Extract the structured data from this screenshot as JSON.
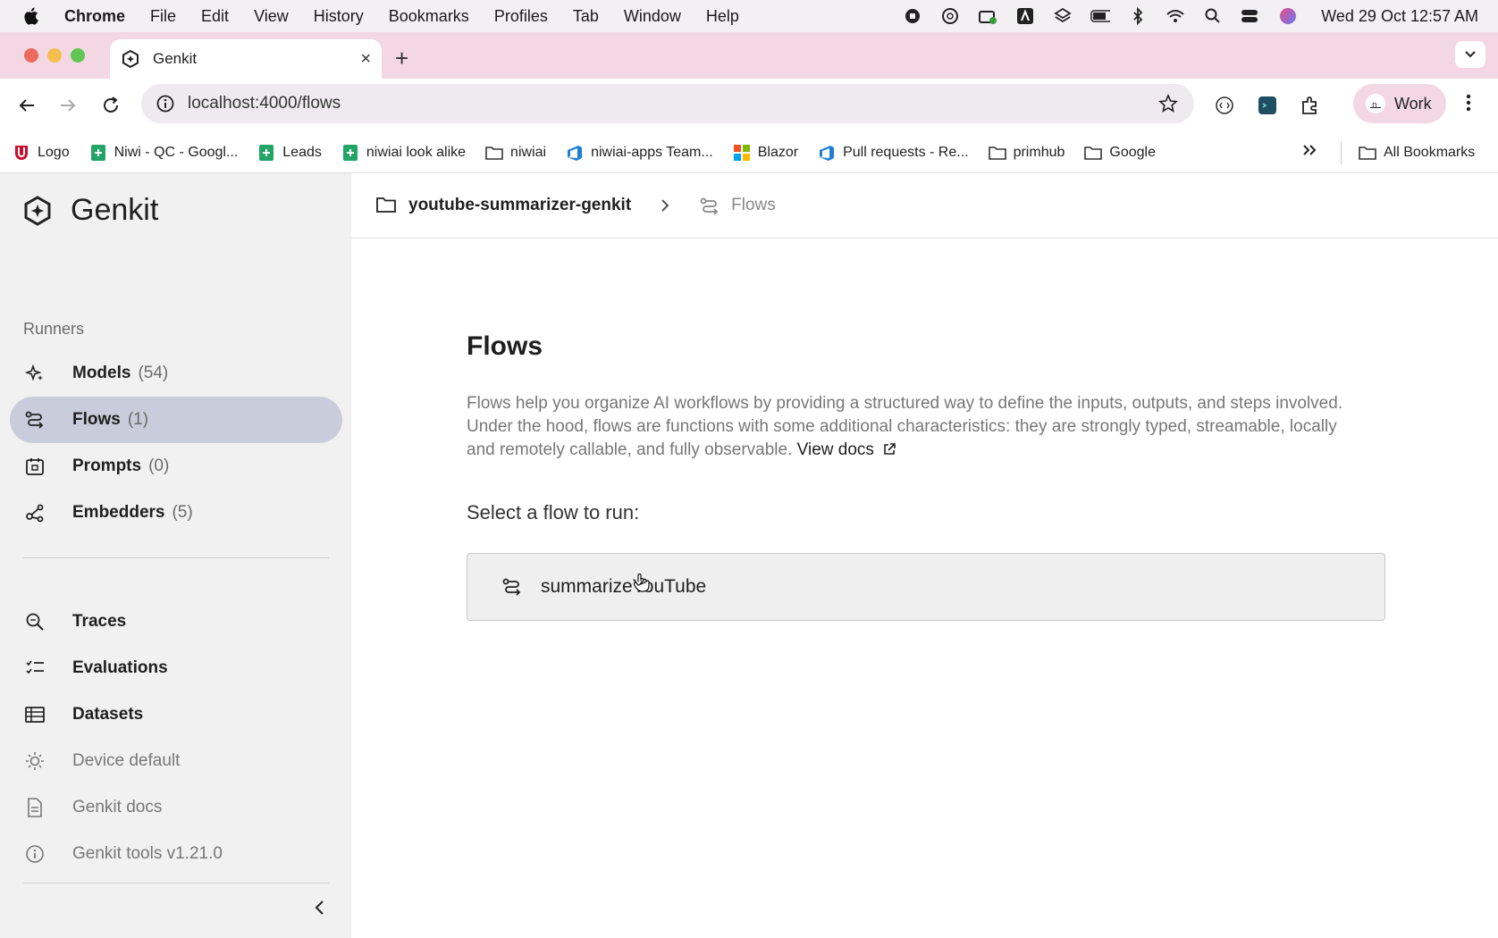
{
  "menubar": {
    "app": "Chrome",
    "items": [
      "File",
      "Edit",
      "View",
      "History",
      "Bookmarks",
      "Profiles",
      "Tab",
      "Window",
      "Help"
    ],
    "clock": "Wed 29 Oct  12:57 AM"
  },
  "browser": {
    "tab_title": "Genkit",
    "url": "localhost:4000/flows",
    "profile_label": "Work",
    "bookmarks": [
      {
        "label": "Logo",
        "icon": "u-logo-icon"
      },
      {
        "label": "Niwi - QC - Googl...",
        "icon": "sheets-icon"
      },
      {
        "label": "Leads",
        "icon": "sheets-icon"
      },
      {
        "label": "niwiai look alike",
        "icon": "sheets-icon"
      },
      {
        "label": "niwiai",
        "icon": "folder-icon"
      },
      {
        "label": "niwiai-apps Team...",
        "icon": "azure-devops-icon"
      },
      {
        "label": "Blazor",
        "icon": "microsoft-icon"
      },
      {
        "label": "Pull requests - Re...",
        "icon": "azure-devops-icon"
      },
      {
        "label": "primhub",
        "icon": "folder-icon"
      },
      {
        "label": "Google",
        "icon": "folder-icon"
      }
    ],
    "all_bookmarks": "All Bookmarks"
  },
  "sidebar": {
    "brand": "Genkit",
    "section": "Runners",
    "runners": [
      {
        "label": "Models",
        "count": "(54)"
      },
      {
        "label": "Flows",
        "count": "(1)"
      },
      {
        "label": "Prompts",
        "count": "(0)"
      },
      {
        "label": "Embedders",
        "count": "(5)"
      }
    ],
    "tools": [
      {
        "label": "Traces"
      },
      {
        "label": "Evaluations"
      },
      {
        "label": "Datasets"
      }
    ],
    "footer": [
      {
        "label": "Device default"
      },
      {
        "label": "Genkit docs"
      },
      {
        "label": "Genkit tools v1.21.0"
      }
    ]
  },
  "breadcrumb": {
    "project": "youtube-summarizer-genkit",
    "current": "Flows"
  },
  "main": {
    "title": "Flows",
    "description": "Flows help you organize AI workflows by providing a structured way to define the inputs, outputs, and steps involved. Under the hood, flows are functions with some additional characteristics: they are strongly typed, streamable, locally and remotely callable, and fully observable.",
    "docs_link": "View docs",
    "select_label": "Select a flow to run:",
    "flows": [
      "summarizeYouTube"
    ]
  },
  "colors": {
    "tabstrip": "#f3d8e3",
    "sidebar": "#f1f1f1",
    "active_nav": "#c9ccda"
  }
}
